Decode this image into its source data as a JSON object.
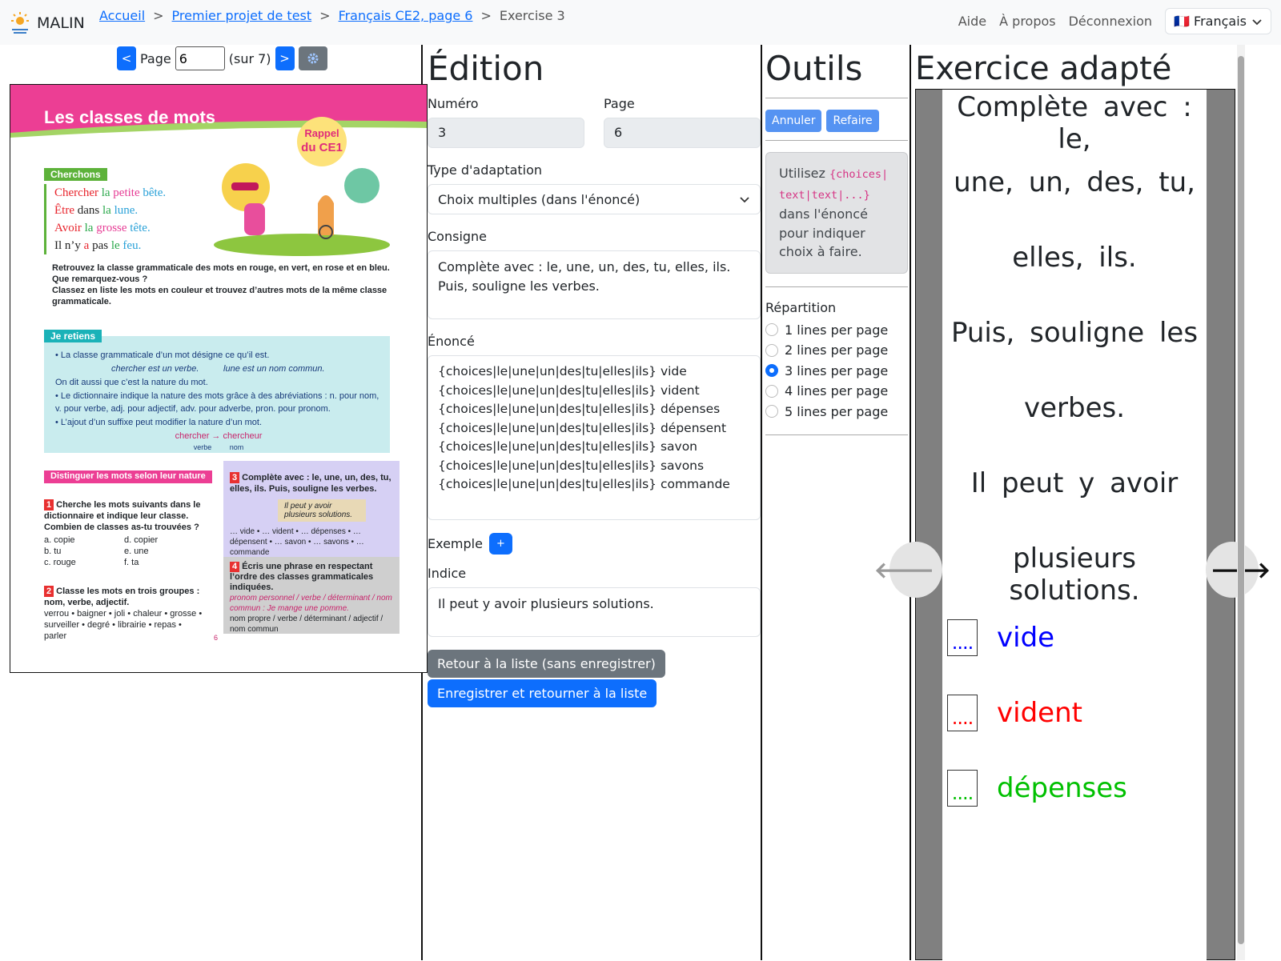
{
  "header": {
    "brand": "MALIN",
    "breadcrumbs": [
      "Accueil",
      "Premier projet de test",
      "Français CE2, page 6"
    ],
    "current": "Exercise 3",
    "nav": [
      "Aide",
      "À propos",
      "Déconnexion"
    ],
    "language": "🇫🇷 Français"
  },
  "pager": {
    "prev": "<",
    "label": "Page",
    "value": "6",
    "total": "(sur 7)",
    "next": ">"
  },
  "textbook": {
    "title": "Les classes de mots",
    "badge_line1": "Rappel",
    "badge_line2": "du CE1",
    "cherchons": "Cherchons",
    "lines": [
      [
        {
          "t": "Chercher",
          "c": "#e8242c"
        },
        {
          "t": " la ",
          "c": "#29a84a"
        },
        {
          "t": "petite",
          "c": "#e63c95"
        },
        {
          "t": " bête.",
          "c": "#29a1d8"
        }
      ],
      [
        {
          "t": "Être",
          "c": "#e8242c"
        },
        {
          "t": " dans ",
          "c": "#222"
        },
        {
          "t": "la",
          "c": "#29a84a"
        },
        {
          "t": " lune.",
          "c": "#29a1d8"
        }
      ],
      [
        {
          "t": "Avoir",
          "c": "#e8242c"
        },
        {
          "t": " la ",
          "c": "#29a84a"
        },
        {
          "t": "grosse",
          "c": "#e63c95"
        },
        {
          "t": " tête.",
          "c": "#29a1d8"
        }
      ],
      [
        {
          "t": "Il n’y ",
          "c": "#222"
        },
        {
          "t": "a",
          "c": "#e8242c"
        },
        {
          "t": " pas ",
          "c": "#222"
        },
        {
          "t": "le",
          "c": "#29a84a"
        },
        {
          "t": " feu.",
          "c": "#29a1d8"
        }
      ]
    ],
    "note1": "Retrouvez la classe grammaticale des mots en rouge, en vert, en rose et en bleu. Que remarquez-vous ?",
    "note2": "Classez en liste les mots en couleur et trouvez d’autres mots de la même classe grammaticale.",
    "retiens": "Je retiens",
    "retiens_lines": [
      "• La classe grammaticale d’un mot désigne ce qu’il est.",
      "chercher est un verbe.          lune est un nom commun.",
      "On dit aussi que c’est la nature du mot.",
      "• Le dictionnaire indique la nature des mots grâce à des abréviations : n. pour nom, v. pour verbe, adj. pour adjectif, adv. pour adverbe, pron. pour pronom.",
      "• L’ajout d’un suffixe peut modifier la nature d’un mot.",
      "chercher → chercheur",
      "verbe         nom"
    ],
    "distinguer": "Distinguer les mots selon leur nature",
    "ex1_num": "1",
    "ex1": "Cherche les mots suivants dans le dictionnaire et indique leur classe. Combien de classes as-tu trouvées ?",
    "ex1_items": [
      "a. copie",
      "d. copier",
      "b. tu",
      "e. une",
      "c. rouge",
      "f. ta"
    ],
    "ex2_num": "2",
    "ex2": "Classe les mots en trois groupes : nom, verbe, adjectif.",
    "ex2_words": "verrou • baigner • joli • chaleur • grosse • surveiller • degré • librairie • repas • parler",
    "ex3_num": "3",
    "ex3": "Complète avec : le, une, un, des, tu, elles, ils. Puis, souligne les verbes.",
    "ex3_bubble": "Il peut y avoir plusieurs solutions.",
    "ex3_items": "… vide • … vident • … dépenses • … dépensent • … savon • … savons • … commande",
    "ex4_num": "4",
    "ex4": "Écris une phrase en respectant l’ordre des classes grammaticales indiquées.",
    "ex4_example": "pronom personnel / verbe / déterminant / nom commun : Je mange une pomme.",
    "ex4_order": "nom propre / verbe / déterminant / adjectif / nom commun",
    "page_number": "6"
  },
  "edition": {
    "heading": "Édition",
    "numero_label": "Numéro",
    "numero": "3",
    "page_label": "Page",
    "page": "6",
    "type_label": "Type d'adaptation",
    "type_value": "Choix multiples (dans l'énoncé)",
    "consigne_label": "Consigne",
    "consigne": "Complète avec : le, une, un, des, tu, elles, ils.\nPuis, souligne les verbes.",
    "enonce_label": "Énoncé",
    "enonce": "{choices|le|une|un|des|tu|elles|ils} vide\n{choices|le|une|un|des|tu|elles|ils} vident\n{choices|le|une|un|des|tu|elles|ils} dépenses\n{choices|le|une|un|des|tu|elles|ils} dépensent\n{choices|le|une|un|des|tu|elles|ils} savon\n{choices|le|une|un|des|tu|elles|ils} savons\n{choices|le|une|un|des|tu|elles|ils} commande",
    "exemple_label": "Exemple",
    "exemple_add": "+",
    "indice_label": "Indice",
    "indice": "Il peut y avoir plusieurs solutions.",
    "back_button": "Retour à la liste (sans enregistrer)",
    "save_button": "Enregistrer et retourner à la liste"
  },
  "tools": {
    "heading": "Outils",
    "undo": "Annuler",
    "redo": "Refaire",
    "hint_pre": "Utilisez ",
    "hint_code": "{choices|text|text|...}",
    "hint_post": " dans l'énoncé pour indiquer choix à faire.",
    "repartition_label": "Répartition",
    "options": [
      "1 lines per page",
      "2 lines per page",
      "3 lines per page",
      "4 lines per page",
      "5 lines per page"
    ],
    "selected_option": "3 lines per page"
  },
  "adapted": {
    "heading": "Exercice adapté",
    "lines": [
      "Complète avec : le,",
      "une, un, des, tu,",
      "elles, ils.",
      "Puis, souligne les",
      "verbes.",
      "Il peut y avoir",
      "plusieurs solutions."
    ],
    "choices": [
      {
        "box": "....",
        "word": "vide",
        "color": "#0000ff"
      },
      {
        "box": "....",
        "word": "vident",
        "color": "#ff0000"
      },
      {
        "box": "....",
        "word": "dépenses",
        "color": "#00c000"
      }
    ],
    "prev_arrow": "🡐",
    "next_arrow": "🡒"
  },
  "colors": {
    "primary": "#0d6efd",
    "secondary": "#6c757d"
  }
}
